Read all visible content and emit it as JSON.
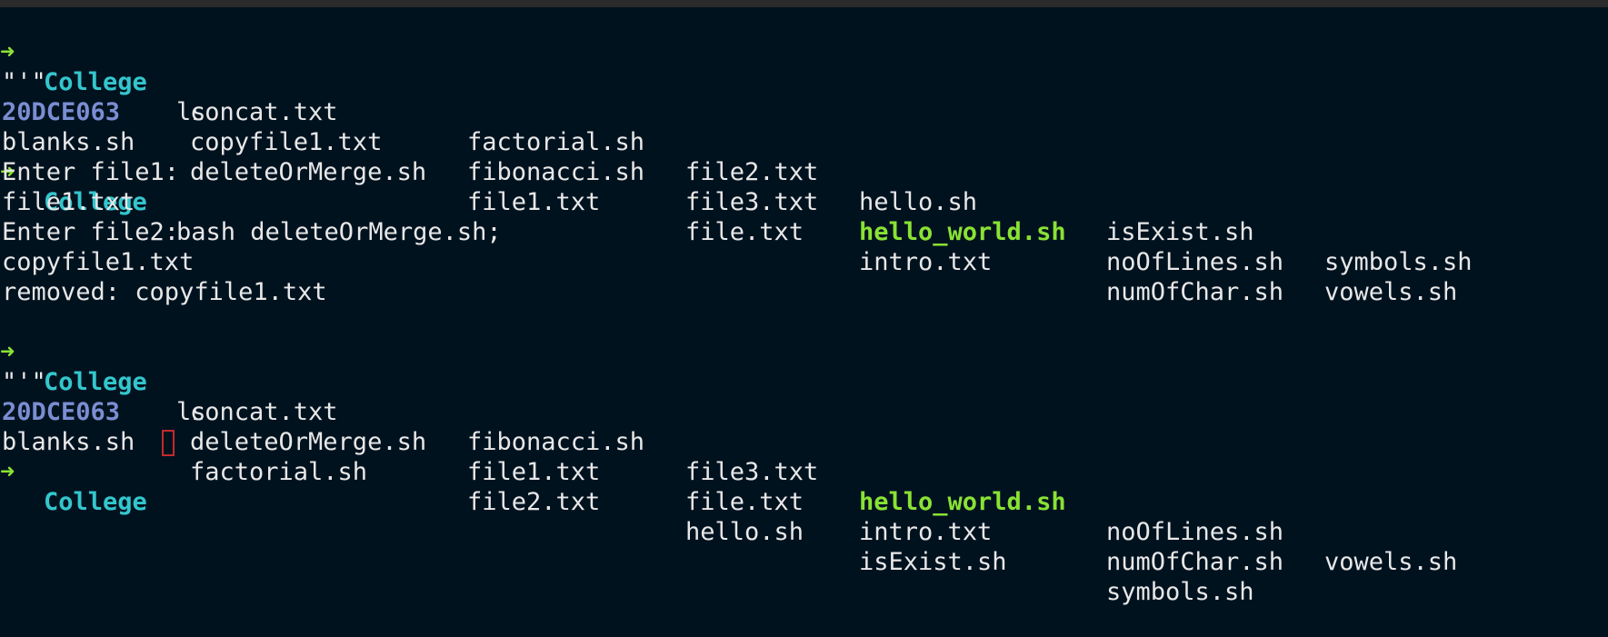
{
  "prompt": {
    "arrow": "➜",
    "dir": "College"
  },
  "commands": {
    "ls1": "ls",
    "bash": "bash deleteOrMerge.sh;",
    "ls2": "ls"
  },
  "listing1": {
    "row1": [
      "\"'\"",
      "concat.txt",
      "factorial.sh",
      "file2.txt",
      "hello.sh",
      "isExist.sh",
      "symbols.sh"
    ],
    "row2": [
      "20DCE063",
      "copyfile1.txt",
      "fibonacci.sh",
      "file3.txt",
      "hello_world.sh",
      "noOfLines.sh",
      "vowels.sh"
    ],
    "row3": [
      "blanks.sh",
      "deleteOrMerge.sh",
      "file1.txt",
      "file.txt",
      "intro.txt",
      "numOfChar.sh"
    ]
  },
  "output": [
    "Enter file1:",
    "file1.txt",
    "Enter file2:",
    "copyfile1.txt",
    "removed: copyfile1.txt"
  ],
  "listing2": {
    "row1": [
      "\"'\"",
      "concat.txt",
      "fibonacci.sh",
      "file3.txt",
      "hello_world.sh",
      "noOfLines.sh",
      "vowels.sh"
    ],
    "row2": [
      "20DCE063",
      "deleteOrMerge.sh",
      "file1.txt",
      "file.txt",
      "intro.txt",
      "numOfChar.sh"
    ],
    "row3": [
      "blanks.sh",
      "factorial.sh",
      "file2.txt",
      "hello.sh",
      "isExist.sh",
      "symbols.sh"
    ]
  },
  "colors": {
    "background": "#01121f",
    "arrow": "#8ae234",
    "dir": "#34c6cd",
    "folder": "#7b8ed3",
    "executable": "#8ae234",
    "cursor": "#c22b2b"
  }
}
